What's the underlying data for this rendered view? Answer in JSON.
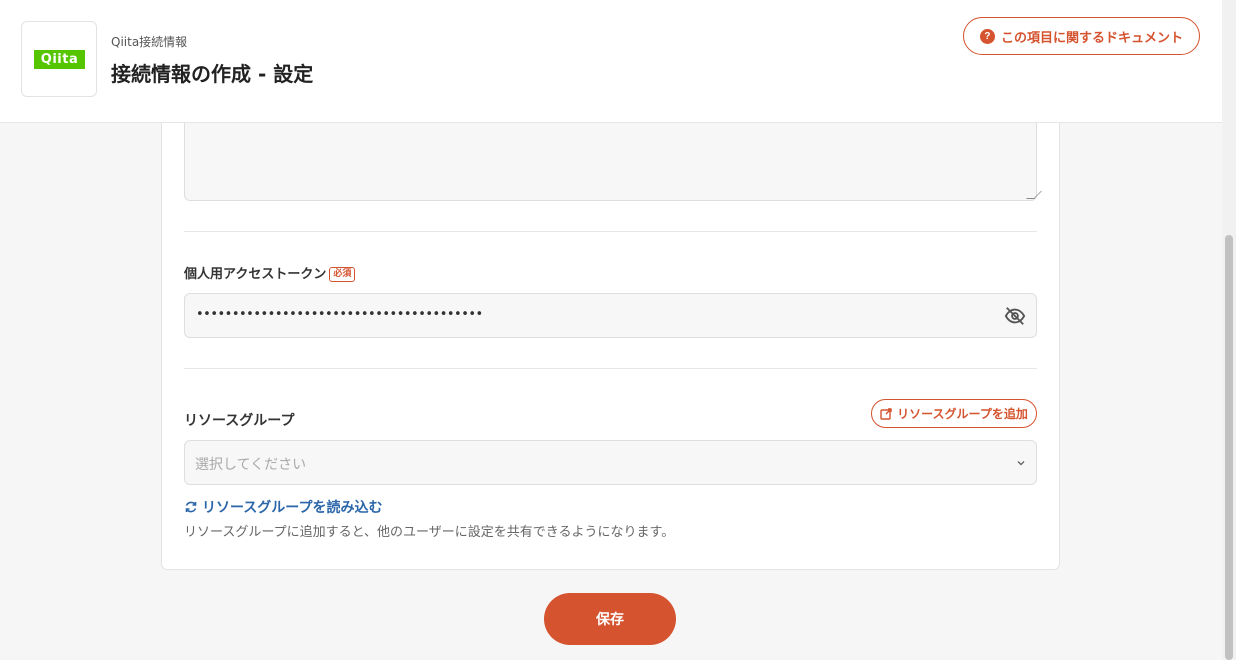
{
  "header": {
    "logo_text": "Qiita",
    "breadcrumb": "Qiita接続情報",
    "title": "接続情報の作成 - 設定",
    "doc_button_label": "この項目に関するドキュメント",
    "help_icon": "help-circle-icon"
  },
  "token": {
    "label": "個人用アクセストークン",
    "required_badge": "必須",
    "value": "••••••••••••••••••••••••••••••••••••••••",
    "toggle_icon": "eye-off-icon"
  },
  "resource_group": {
    "label": "リソースグループ",
    "add_button_label": "リソースグループを追加",
    "add_icon": "external-link-icon",
    "placeholder": "選択してください",
    "reload_label": "リソースグループを読み込む",
    "reload_icon": "refresh-icon",
    "help_text": "リソースグループに追加すると、他のユーザーに設定を共有できるようになります。"
  },
  "actions": {
    "save_label": "保存"
  },
  "colors": {
    "accent": "#d5532f",
    "link": "#2b66a8",
    "qiita_green": "#55c500"
  }
}
